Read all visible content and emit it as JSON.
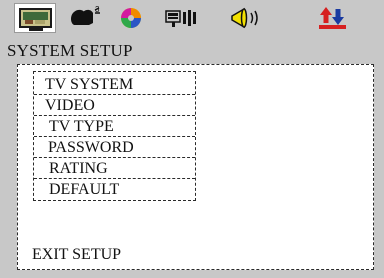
{
  "toolbar": {
    "tabs": [
      {
        "icon": "tv-monitor-icon",
        "active": true
      },
      {
        "icon": "speaking-head-icon",
        "active": false
      },
      {
        "icon": "disc-icon",
        "active": false
      },
      {
        "icon": "speaker-bars-icon",
        "active": false
      },
      {
        "icon": "megaphone-icon",
        "active": false
      },
      {
        "icon": "updown-arrows-icon",
        "active": false
      }
    ]
  },
  "header": {
    "title": "SYSTEM SETUP"
  },
  "menu": {
    "items": [
      {
        "label": "TV SYSTEM"
      },
      {
        "label": "VIDEO"
      },
      {
        "label": "TV TYPE"
      },
      {
        "label": "PASSWORD"
      },
      {
        "label": "RATING"
      },
      {
        "label": "DEFAULT"
      }
    ]
  },
  "footer": {
    "exit_label": "EXIT SETUP"
  },
  "colors": {
    "background": "#c8c8c8",
    "panel": "#ffffff",
    "accent_red": "#d62020",
    "accent_blue": "#1a3aa0",
    "accent_yellow": "#f2e000"
  }
}
